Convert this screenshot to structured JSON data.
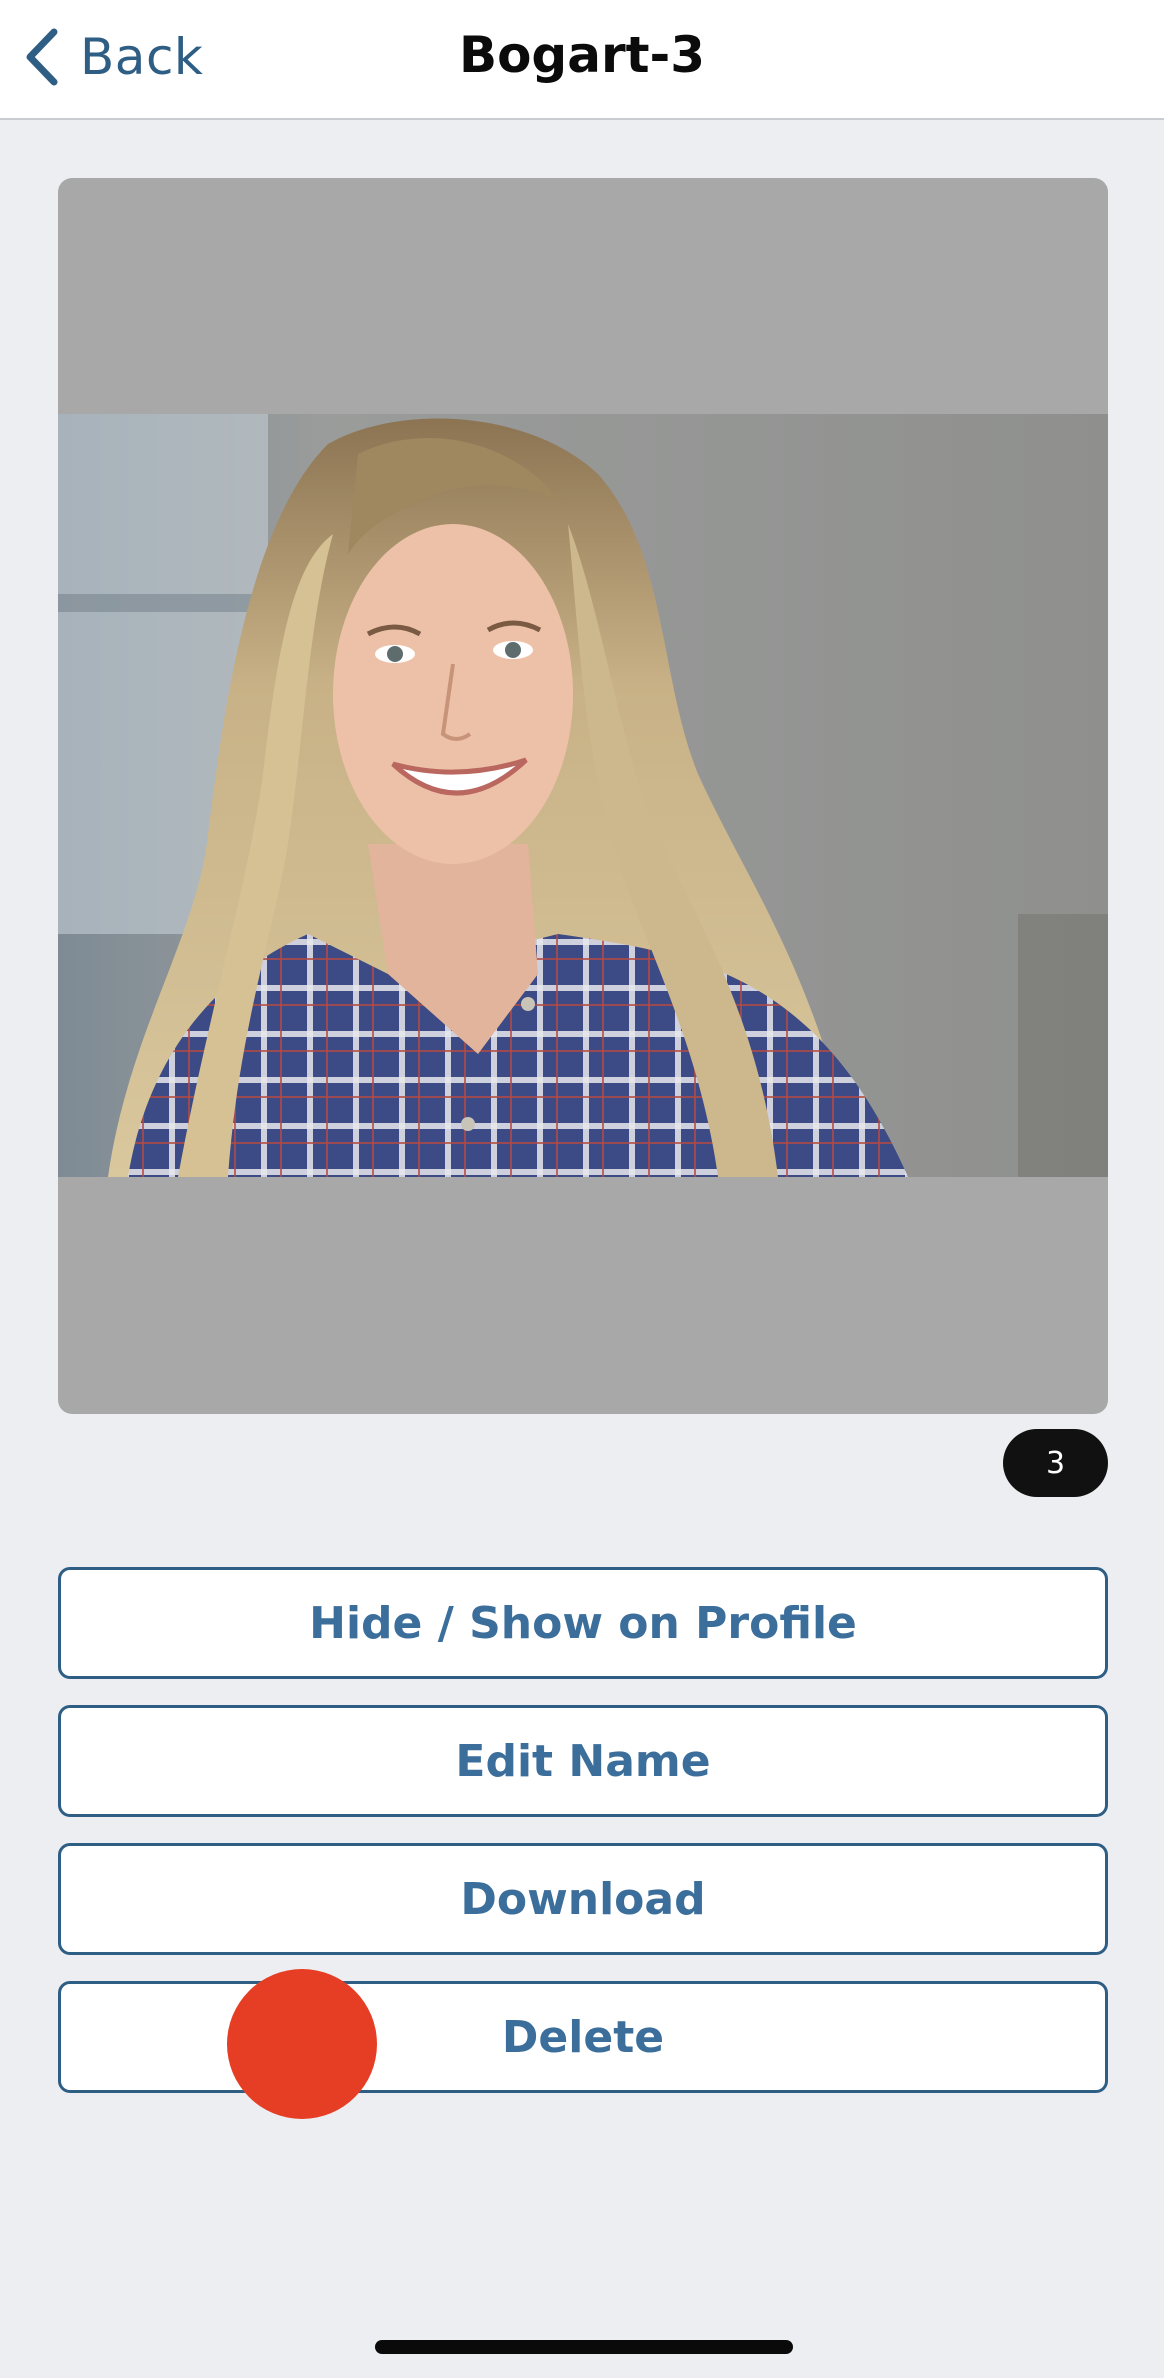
{
  "nav": {
    "back_label": "Back",
    "back_icon": "chevron-left-icon",
    "title": "Bogart-3"
  },
  "photo": {
    "alt": "Headshot of a smiling woman with long wavy blonde hair wearing a blue plaid shirt"
  },
  "badge": {
    "count": "3"
  },
  "actions": {
    "hide_show": "Hide / Show on Profile",
    "edit_name": "Edit Name",
    "download": "Download",
    "delete": "Delete"
  },
  "colors": {
    "accent": "#2F5E85",
    "button_text": "#3B6E9B",
    "background": "#ECEEF2",
    "touch_indicator": "#E63E24"
  }
}
